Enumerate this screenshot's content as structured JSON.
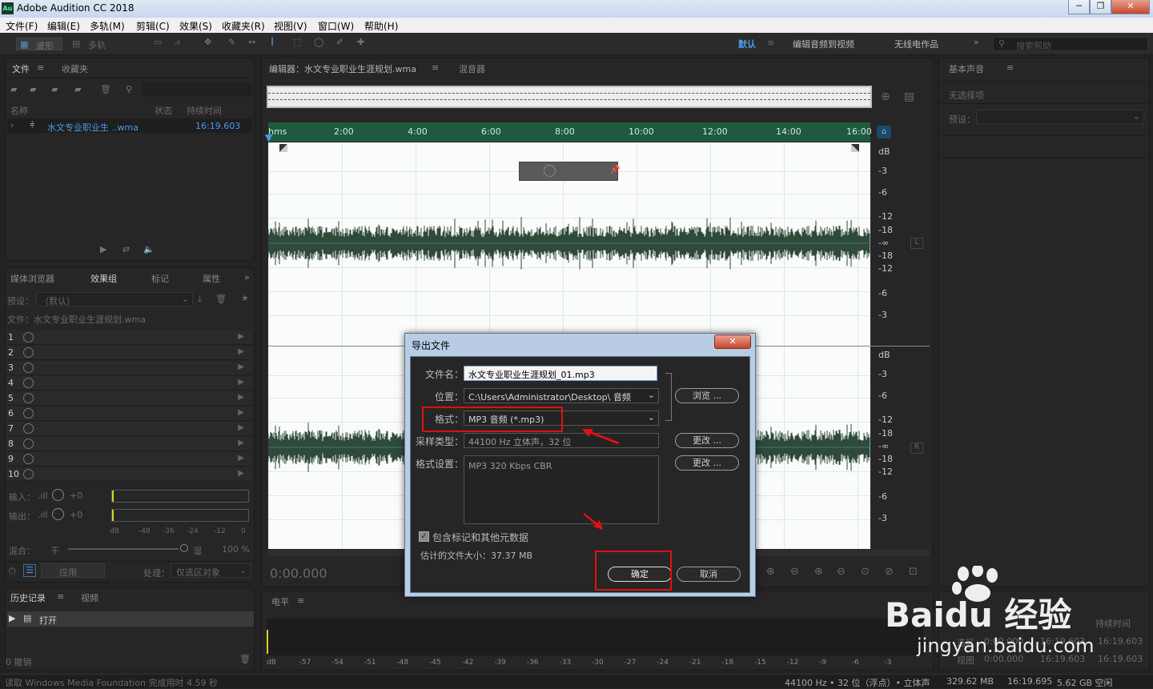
{
  "window": {
    "title": "Adobe Audition CC 2018",
    "logo": "Au"
  },
  "menu": [
    "文件(F)",
    "编辑(E)",
    "多轨(M)",
    "剪辑(C)",
    "效果(S)",
    "收藏夹(R)",
    "视图(V)",
    "窗口(W)",
    "帮助(H)"
  ],
  "toolbar": {
    "waveform": "波形",
    "multitrack": "多轨",
    "workspaces": [
      "默认",
      "编辑音频到视频",
      "无线电作品"
    ],
    "search_placeholder": "搜索帮助"
  },
  "files_panel": {
    "tabs": [
      "文件",
      "收藏夹"
    ],
    "columns": {
      "name": "名称",
      "status": "状态",
      "duration": "持续时间"
    },
    "file": {
      "name": "水文专业职业生 ..wma",
      "duration": "16:19.603"
    }
  },
  "effects_panel": {
    "tabs": [
      "媒体浏览器",
      "效果组",
      "标记",
      "属性"
    ],
    "preset_label": "预设：",
    "preset_value": "（默认）",
    "file_line": "文件：水文专业职业生涯规划.wma",
    "rows": [
      "1",
      "2",
      "3",
      "4",
      "5",
      "6",
      "7",
      "8",
      "9",
      "10"
    ],
    "input_label": "输入：",
    "output_label": "输出：",
    "gain": "+0",
    "meter_scale": [
      "dB",
      "-48",
      "-36",
      "-24",
      "-12",
      "0"
    ],
    "mix_label": "混合：",
    "mix_dry": "干",
    "mix_wet": "湿",
    "mix_pct": "100 %",
    "apply": "应用",
    "process_label": "处理：",
    "process_value": "仅选区对象"
  },
  "history_panel": {
    "tabs": [
      "历史记录",
      "视频"
    ],
    "item": "打开",
    "undo": "0 撤销"
  },
  "editor": {
    "tab_title": "编辑器：水文专业职业生涯规划.wma",
    "mixer_tab": "混音器",
    "ruler": [
      "hms",
      "2:00",
      "4:00",
      "6:00",
      "8:00",
      "10:00",
      "12:00",
      "14:00",
      "16:00"
    ],
    "db_top": [
      "dB",
      "-3",
      "-6",
      "-12",
      "-18",
      "-∞",
      "-18",
      "-12",
      "-6",
      "-3"
    ],
    "db_bottom": [
      "dB",
      "-3",
      "-6",
      "-12",
      "-18",
      "-∞",
      "-18",
      "-12",
      "-6",
      "-3"
    ],
    "channel_l": "L",
    "channel_r": "R",
    "time": "0:00.000"
  },
  "levels_panel": {
    "title": "电平",
    "scale": [
      "dB",
      "-57",
      "-54",
      "-51",
      "-48",
      "-45",
      "-42",
      "-39",
      "-36",
      "-33",
      "-30",
      "-27",
      "-24",
      "-21",
      "-18",
      "-15",
      "-12",
      "-9",
      "-6",
      "-3"
    ]
  },
  "essential_panel": {
    "title": "基本声音",
    "no_selection": "无选择项",
    "preset_label": "预设："
  },
  "selection_panel": {
    "duration_label": "持续时间",
    "row1": [
      "选区",
      "0:00.000",
      "16:19.603",
      "16:19.603"
    ],
    "row2": [
      "视图",
      "0:00.000",
      "16:19.603",
      "16:19.603"
    ]
  },
  "status_bar": {
    "left": "读取 Windows Media Foundation 完成用时 4.59 秒",
    "format": "44100 Hz • 32 位（浮点）• 立体声",
    "size": "329.62 MB",
    "duration": "16:19.695",
    "free": "5.62 GB 空闲"
  },
  "dialog": {
    "title": "导出文件",
    "filename_label": "文件名：",
    "filename_value": "水文专业职业生涯规划_01.mp3",
    "location_label": "位置：",
    "location_value": "C:\\Users\\Administrator\\Desktop\\ 音频",
    "browse": "浏览 ...",
    "format_label": "格式：",
    "format_value": "MP3 音频 (*.mp3)",
    "sample_label": "采样类型：",
    "sample_value": "44100 Hz 立体声，32 位",
    "change1": "更改 ...",
    "settings_label": "格式设置：",
    "settings_value": "MP3 320 Kbps CBR",
    "change2": "更改 ...",
    "include_markers": "包含标记和其他元数据",
    "estimated_size": "估计的文件大小：37.37 MB",
    "ok": "确定",
    "cancel": "取消",
    "close": "✕"
  },
  "watermark": {
    "brand": "Baidu 经验",
    "url": "jingyan.baidu.com"
  },
  "colors": {
    "waveform": "#2e4a3a",
    "accent": "#2d8ceb",
    "highlight": "#e01010",
    "ruler": "#1f5a40"
  }
}
